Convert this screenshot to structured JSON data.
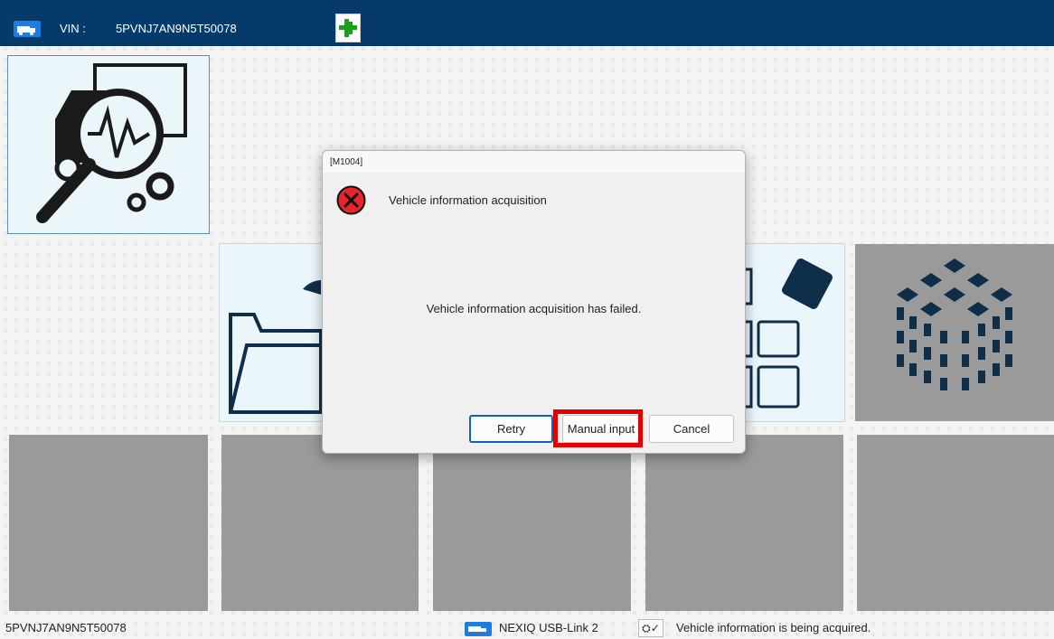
{
  "header": {
    "vin_label": "VIN :",
    "vin_value": "5PVNJ7AN9N5T50078",
    "truck_icon": "truck-icon",
    "connection_icon": "plug-connected-icon",
    "background_color": "#063a6b"
  },
  "tiles": {
    "diagnosis_icon": "truck-diagnosis-icon",
    "folder_icon": "folder-icon",
    "grid_icon": "grid-blocks-icon",
    "cube_icon": "cube-icon"
  },
  "dialog": {
    "code": "[M1004]",
    "heading": "Vehicle information acquisition",
    "message": "Vehicle information acquisition has failed.",
    "error_icon": "error-icon",
    "buttons": {
      "retry": "Retry",
      "manual_input": "Manual input",
      "cancel": "Cancel"
    },
    "highlight_color": "#e00000"
  },
  "status_bar": {
    "vin": "5PVNJ7AN9N5T50078",
    "device": "NEXIQ USB-Link 2",
    "status_icon": "connection-check-icon",
    "status_message": "Vehicle information is being acquired."
  }
}
